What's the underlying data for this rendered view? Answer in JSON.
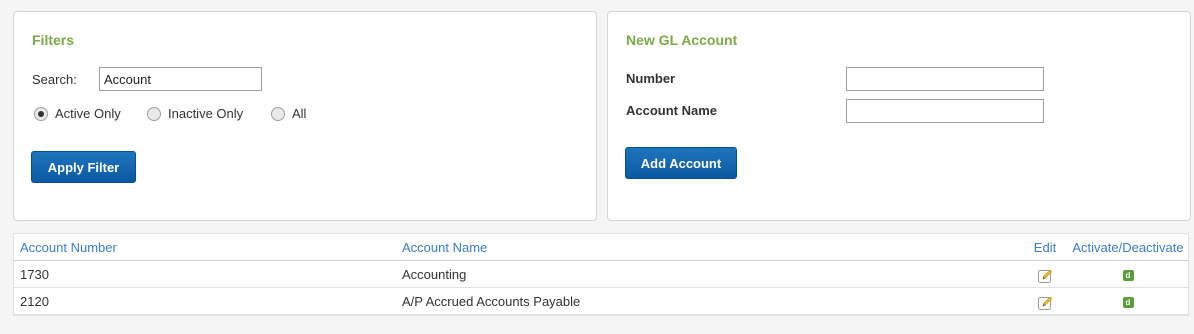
{
  "filters": {
    "title": "Filters",
    "search_label": "Search:",
    "search_value": "Account",
    "radios": [
      {
        "label": "Active Only",
        "checked": true
      },
      {
        "label": "Inactive Only",
        "checked": false
      },
      {
        "label": "All",
        "checked": false
      }
    ],
    "apply_label": "Apply Filter"
  },
  "new_account": {
    "title": "New GL Account",
    "number_label": "Number",
    "number_value": "",
    "name_label": "Account Name",
    "name_value": "",
    "add_label": "Add Account"
  },
  "table": {
    "headers": {
      "number": "Account Number",
      "name": "Account Name",
      "edit": "Edit",
      "activate": "Activate/Deactivate"
    },
    "rows": [
      {
        "number": "1730",
        "name": "Accounting",
        "toggle": "d"
      },
      {
        "number": "2120",
        "name": "A/P Accrued Accounts Payable",
        "toggle": "d"
      }
    ]
  },
  "colors": {
    "panel_title": "#7aaa4a",
    "header_link": "#3a7fc5",
    "button": "#1565ad",
    "deactivate_badge": "#5a9e3a"
  },
  "icons": {
    "edit": "pencil-edit-icon",
    "deactivate": "deactivate-d-icon"
  }
}
